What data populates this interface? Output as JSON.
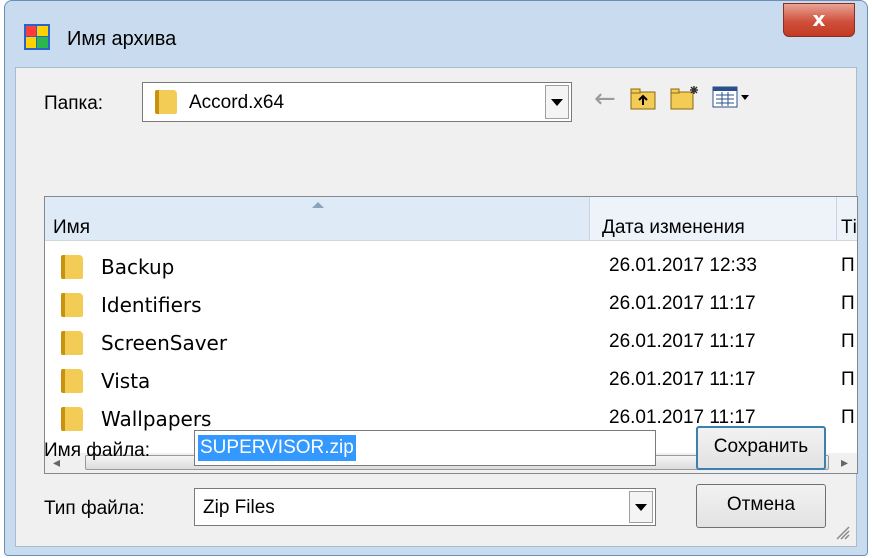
{
  "window": {
    "title": "Имя архива",
    "close_symbol": "x"
  },
  "toolbar": {
    "folder_label": "Папка:",
    "folder_value": "Accord.x64",
    "icons": [
      "back-arrow-icon",
      "up-folder-icon",
      "new-folder-icon",
      "view-menu-icon"
    ]
  },
  "list": {
    "columns": [
      {
        "label": "Имя"
      },
      {
        "label": "Дата изменения"
      },
      {
        "label": "Ті"
      }
    ],
    "rows": [
      {
        "name": "Backup",
        "date": "26.01.2017 12:33",
        "type": "П"
      },
      {
        "name": "Identifiers",
        "date": "26.01.2017 11:17",
        "type": "П"
      },
      {
        "name": "ScreenSaver",
        "date": "26.01.2017 11:17",
        "type": "П"
      },
      {
        "name": "Vista",
        "date": "26.01.2017 11:17",
        "type": "П"
      },
      {
        "name": "Wallpapers",
        "date": "26.01.2017 11:17",
        "type": "П"
      }
    ],
    "scroll_thumb_text": "III"
  },
  "form": {
    "filename_label": "Имя файла:",
    "filename_value": "SUPERVISOR.zip",
    "filetype_label": "Тип файла:",
    "filetype_value": "Zip Files",
    "save_label": "Сохранить",
    "cancel_label": "Отмена"
  }
}
